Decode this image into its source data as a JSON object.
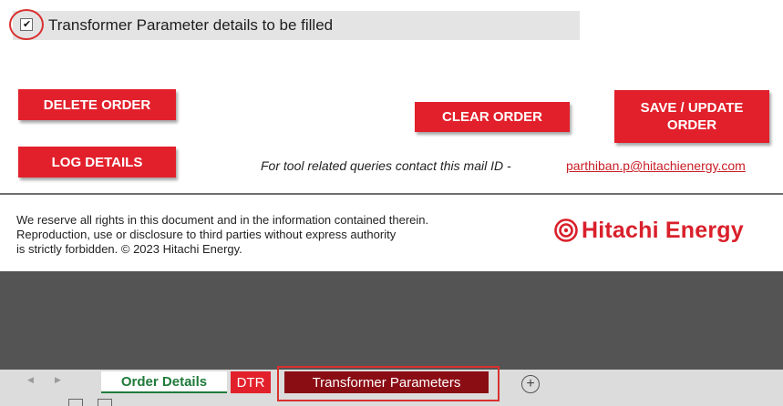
{
  "checkbox": {
    "label": "Transformer Parameter details to be filled",
    "checked": true,
    "check_glyph": "✔"
  },
  "buttons": {
    "delete_order": "DELETE ORDER",
    "log_details": "LOG DETAILS",
    "clear_order": "CLEAR ORDER",
    "save_update_line1": "SAVE / UPDATE",
    "save_update_line2": "ORDER"
  },
  "contact": {
    "text": "For tool related queries contact this mail ID -",
    "email": "parthiban.p@hitachienergy.com"
  },
  "footer": {
    "line1": "We reserve all rights in this document and in the information contained therein.",
    "line2": "Reproduction, use or disclosure to third parties without express authority",
    "line3": "is strictly forbidden. © 2023 Hitachi Energy."
  },
  "brand": {
    "name": "Hitachi Energy",
    "logo_icon": "hitachi-energy-logo",
    "color": "#d9202b"
  },
  "tabs": [
    {
      "label": "Order Details",
      "color": "#1f7a3a"
    },
    {
      "label": "DTR",
      "color": "#e2202b"
    },
    {
      "label": "Transformer Parameters",
      "color": "#8b0d14",
      "active": true
    }
  ],
  "tabbar": {
    "prev_icon": "◀",
    "next_icon": "▶",
    "add_icon": "+"
  },
  "colors": {
    "accent_red": "#e2202b",
    "annotation_red": "#d9302f"
  }
}
